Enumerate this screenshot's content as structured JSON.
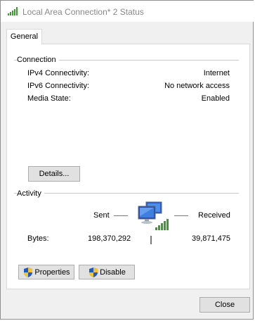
{
  "window": {
    "title": "Local Area Connection* 2 Status",
    "title_icon": "wifi-signal-icon"
  },
  "tabs": [
    {
      "label": "General",
      "selected": true
    }
  ],
  "connection": {
    "group_label": "Connection",
    "rows": [
      {
        "label": "IPv4 Connectivity:",
        "value": "Internet"
      },
      {
        "label": "IPv6 Connectivity:",
        "value": "No network access"
      },
      {
        "label": "Media State:",
        "value": "Enabled"
      }
    ],
    "details_button": "Details..."
  },
  "activity": {
    "group_label": "Activity",
    "sent_label": "Sent",
    "received_label": "Received",
    "bytes_label": "Bytes:",
    "bytes_sent": "198,370,292",
    "bytes_received": "39,871,475",
    "icon": "network-computers-icon"
  },
  "buttons": {
    "properties": "Properties",
    "disable": "Disable",
    "close": "Close"
  },
  "colors": {
    "signal_green": "#3c9a2e",
    "button_face": "#e1e1e1",
    "button_border": "#adadad",
    "title_text": "#888888"
  }
}
